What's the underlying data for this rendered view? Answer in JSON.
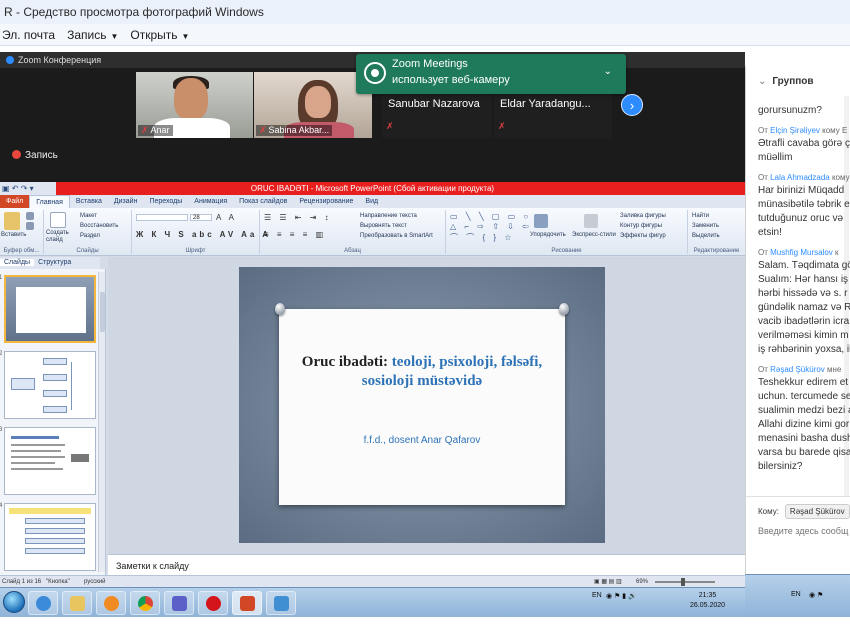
{
  "photo_viewer": {
    "title": "R - Средство просмотра фотографий Windows",
    "menu": [
      {
        "label": "Эл. почта"
      },
      {
        "label": "Запись",
        "dropdown": true
      },
      {
        "label": "Открыть",
        "dropdown": true
      }
    ]
  },
  "zoom": {
    "window_title": "Zoom Конференция",
    "participants": [
      {
        "name": "Anar"
      },
      {
        "name": "Sabina Akbar..."
      },
      {
        "name": "Sanubar Nazarova"
      },
      {
        "name": "Eldar  Yaradangu..."
      }
    ],
    "toast": {
      "title": "Zoom Meetings",
      "text": "использует веб-камеру"
    },
    "recording_label": "Запись"
  },
  "powerpoint": {
    "title": "ORUC IBADƏTI - Microsoft PowerPoint (Сбой активации продукта)",
    "tabs": [
      {
        "label": "Файл"
      },
      {
        "label": "Главная",
        "active": true
      },
      {
        "label": "Вставка"
      },
      {
        "label": "Дизайн"
      },
      {
        "label": "Переходы"
      },
      {
        "label": "Анимация"
      },
      {
        "label": "Показ слайдов"
      },
      {
        "label": "Рецензирование"
      },
      {
        "label": "Вид"
      }
    ],
    "ribbon": {
      "paste": "Вставить",
      "new_slide": "Создать слайд",
      "layout": "Макет",
      "reset": "Восстановить",
      "section": "Раздел",
      "font_size": "28",
      "text_direction": "Направление текста",
      "align_text": "Выровнять текст",
      "smartart": "Преобразовать в SmartArt",
      "arrange": "Упорядочить",
      "quick_styles": "Экспресс-стили",
      "shape_fill": "Заливка фигуры",
      "shape_outline": "Контур фигуры",
      "shape_effects": "Эффекты фигур",
      "find": "Найти",
      "replace": "Заменить",
      "select": "Выделить",
      "groups": {
        "clipboard": "Буфер обм...",
        "slides": "Слайды",
        "font": "Шрифт",
        "paragraph": "Абзац",
        "drawing": "Рисование",
        "editing": "Редактирование"
      }
    },
    "pane_tabs": [
      {
        "label": "Слайды",
        "active": true
      },
      {
        "label": "Структура"
      }
    ],
    "thumb_numbers": [
      "1",
      "2",
      "3",
      "4"
    ],
    "slide": {
      "title_dark": "Oruc ibadəti: ",
      "title_blue": "teoloji, psixoloji, fəlsəfi, sosioloji müstəvidə",
      "subtitle": "f.f.d., dosent Anar Qafarov"
    },
    "notes_placeholder": "Заметки к слайду",
    "status": {
      "slide_info": "Слайд 1 из 16",
      "theme": "\"Кнопка\"",
      "language": "русский",
      "zoom": "69%"
    }
  },
  "taskbar": {
    "lang": "EN",
    "time": "21:35",
    "date": "26.05.2020"
  },
  "taskbar_right": {
    "lang": "EN"
  },
  "chat": {
    "header": "Группов",
    "messages": [
      {
        "from": "",
        "to": "",
        "lines": [
          "gorursunuzm?"
        ]
      },
      {
        "from": "Elçin Şirəliyev",
        "to": "кому Е",
        "lines": [
          "Ətrafli cavaba görə ç",
          "müəllim"
        ]
      },
      {
        "from": "Lala Ahmadzada",
        "to": "кому",
        "lines": [
          "Har birinizi Müqadd",
          "münasibətilə təbrik e",
          "tutduğunuz oruc və",
          "etsin!"
        ]
      },
      {
        "from": "Mushfig Mursalov",
        "to": "к",
        "lines": [
          "Salam. Təqdimata gö",
          "Sualım: Hər hansı iş",
          "hərbi hissədə və s. r",
          "gündəlik namaz və R",
          "vacib ibadətlərin icra",
          "verilməməsi kimin m",
          "iş rəhbərinin yoxsa, il"
        ]
      },
      {
        "from": "Rəşad Şükürov",
        "to": "мне",
        "lines": [
          "Teshekkur edirem et",
          "uchun. tercumede se",
          "sualimin medzi bezi a",
          "Allahi dizine kimi gor",
          "menasini basha dush",
          "varsa bu barede qisa",
          "bilersiniz?"
        ]
      }
    ],
    "to_label": "Кому:",
    "to_value": "Rəşad Şükürov",
    "input_placeholder": "Введите здесь сообщ"
  }
}
